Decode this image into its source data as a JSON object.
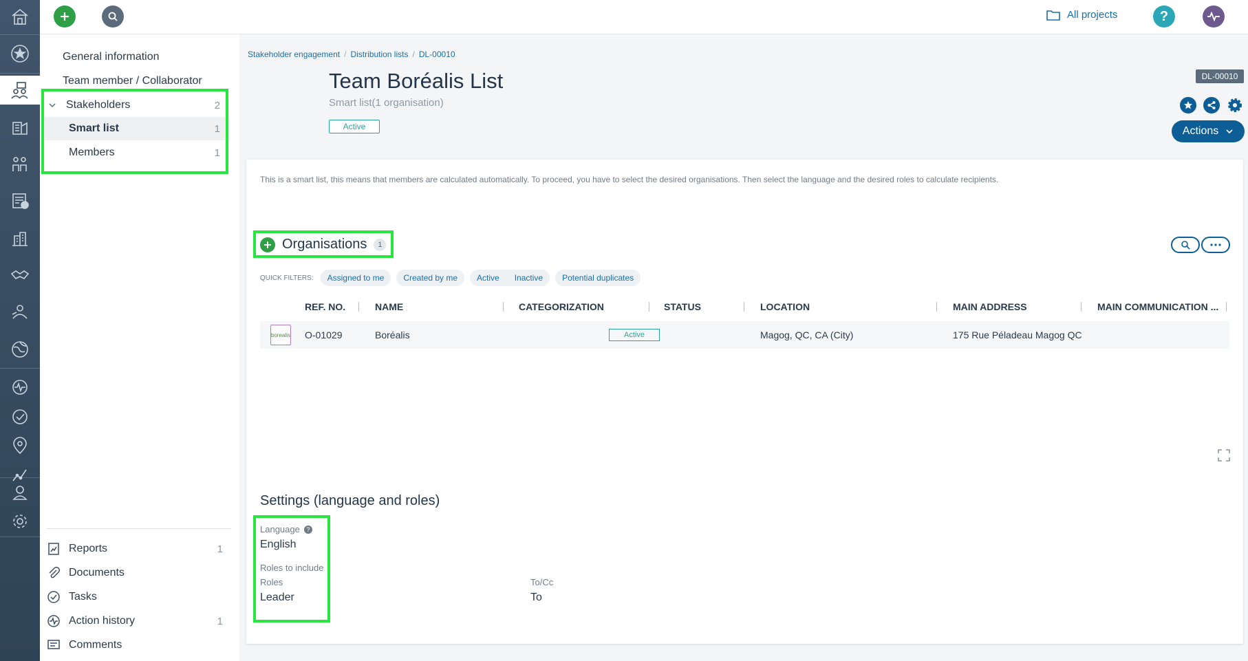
{
  "topbar": {
    "all_projects_label": "All projects",
    "help_label": "?"
  },
  "subnav": {
    "general_information": "General information",
    "team_member": "Team member / Collaborator",
    "stakeholders": {
      "label": "Stakeholders",
      "count": "2"
    },
    "smart_list": {
      "label": "Smart list",
      "count": "1"
    },
    "members": {
      "label": "Members",
      "count": "1"
    },
    "bottom": [
      {
        "label": "Reports",
        "count": "1"
      },
      {
        "label": "Documents",
        "count": ""
      },
      {
        "label": "Tasks",
        "count": ""
      },
      {
        "label": "Action history",
        "count": "1"
      },
      {
        "label": "Comments",
        "count": ""
      }
    ]
  },
  "breadcrumb": [
    "Stakeholder engagement",
    "Distribution lists",
    "DL-00010"
  ],
  "header": {
    "title": "Team Boréalis List",
    "subtitle": "Smart list(1 organisation)",
    "status": "Active",
    "ref": "DL-00010",
    "actions_label": "Actions"
  },
  "panel": {
    "intro": "This is a smart list, this means that members are calculated automatically. To proceed, you have to select the desired organisations. Then select the language and the desired roles to calculate recipients.",
    "organisations": {
      "title": "Organisations",
      "count": "1",
      "quick_filters_label": "QUICK FILTERS:",
      "filters": [
        "Assigned to me",
        "Created by me",
        "Active",
        "Inactive",
        "Potential duplicates"
      ],
      "columns": [
        "REF. NO.",
        "NAME",
        "CATEGORIZATION",
        "STATUS",
        "LOCATION",
        "MAIN ADDRESS",
        "MAIN COMMUNICATION ..."
      ],
      "rows": [
        {
          "logo_text": "borealis",
          "ref": "O-01029",
          "name": "Boréalis",
          "categorization": "",
          "status": "Active",
          "location": "Magog, QC, CA (City)",
          "address": "175 Rue Péladeau Magog QC ⌄",
          "communication": ""
        }
      ]
    },
    "settings": {
      "title": "Settings (language and roles)",
      "language_label": "Language",
      "language_value": "English",
      "roles_to_include_label": "Roles to include",
      "roles_label": "Roles",
      "roles_value": "Leader",
      "tocc_label": "To/Cc",
      "tocc_value": "To"
    }
  },
  "colors": {
    "highlight": "#28e540",
    "primary": "#0d5e96",
    "add_green": "#2e9e47",
    "status_teal": "#2ba29c"
  }
}
